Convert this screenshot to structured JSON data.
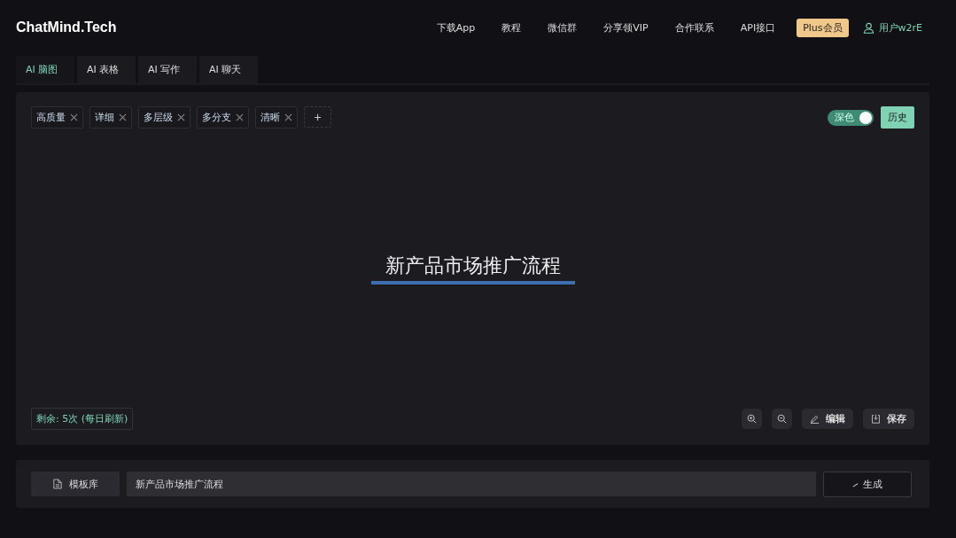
{
  "header": {
    "logo": "ChatMind.Tech",
    "nav": [
      "下载App",
      "教程",
      "微信群",
      "分享领VIP",
      "合作联系",
      "API接口"
    ],
    "plus": "Plus会员",
    "user": "用户w2rE"
  },
  "tabs": [
    {
      "label": "AI 脑图",
      "selected": true
    },
    {
      "label": "AI 表格",
      "selected": false
    },
    {
      "label": "AI 写作",
      "selected": false
    },
    {
      "label": "AI 聊天",
      "selected": false
    }
  ],
  "tags": [
    "高质量",
    "详细",
    "多层级",
    "多分支",
    "清晰"
  ],
  "add_tag": "+",
  "theme_toggle": {
    "label": "深色",
    "on": true
  },
  "history_button": "历史",
  "mindmap": {
    "root": "新产品市场推广流程"
  },
  "quota": "剩余: 5次 (每日刷新)",
  "actions": [
    "编辑",
    "保存"
  ],
  "bottom": {
    "template_button": "模板库",
    "input_value": "新产品市场推广流程",
    "generate_button": "生成"
  }
}
